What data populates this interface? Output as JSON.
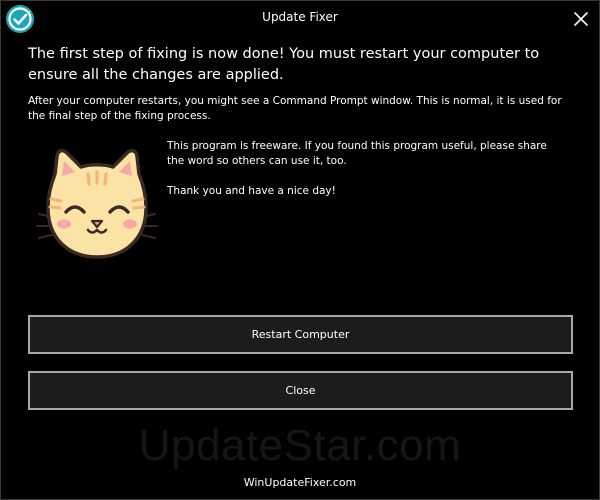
{
  "window": {
    "title": "Update Fixer"
  },
  "message": {
    "headline": "The first step of fixing is now done! You must restart your computer to ensure all the changes are applied.",
    "subtext": "After your computer restarts, you might see a Command Prompt window. This is normal, it is used for the final step of the fixing process.",
    "freeware": "This program is freeware. If you found this program useful, please share the word so others can use it, too.",
    "thanks": "Thank you and have a nice day!"
  },
  "buttons": {
    "restart_label": "Restart Computer",
    "close_label": "Close"
  },
  "watermark": {
    "text": "UpdateStar.com"
  },
  "footer": {
    "link_text": "WinUpdateFixer.com"
  },
  "icons": {
    "app": "refresh-check-icon",
    "close": "close-icon",
    "illustration": "happy-cat-icon"
  },
  "colors": {
    "background": "#000000",
    "accent": "#1aa6b7",
    "button_border": "#a8a8a8",
    "cat_fill": "#fbe3a6",
    "cat_cheeks": "#f6a7a7",
    "cat_stripes": "#f5b57a"
  }
}
